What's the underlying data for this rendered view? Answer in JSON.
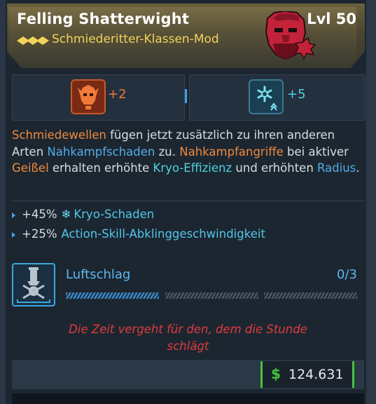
{
  "item": {
    "name": "Felling Shatterwight",
    "level": "Lvl 50",
    "type": "Schmiederitter-Klassen-Mod"
  },
  "skills": [
    {
      "icon": "fire-skull-icon",
      "bonus": "+2"
    },
    {
      "icon": "cryo-snowflake-icon",
      "bonus": "+5"
    }
  ],
  "description": {
    "p1": "Schmiedewellen",
    "p2": " fügen jetzt zusätzlich zu ihren anderen Arten ",
    "p3": "Nahkampfschaden",
    "p4": " zu. ",
    "p5": "Nahkampfangriffe",
    "p6": " bei aktiver ",
    "p7": "Geißel",
    "p8": " erhalten erhöhte ",
    "p9": "Kryo-Effizienz",
    "p10": " und erhöhten ",
    "p11": "Radius",
    "p12": "."
  },
  "stats": [
    {
      "value": "+45%",
      "label": "Kryo-Schaden",
      "icon": "snowflake-icon"
    },
    {
      "value": "+25%",
      "label": "Action-Skill-Abklinggeschwindigkeit"
    }
  ],
  "augment": {
    "name": "Luftschlag",
    "count": "0/3",
    "icon": "airstrike-skull-icon",
    "progress": 0
  },
  "flavor": {
    "line1": "Die Zeit vergeht für den, dem die Stunde",
    "line2": "schlägt"
  },
  "price": {
    "symbol": "$",
    "value": "124.631"
  },
  "colors": {
    "header_gold": "#6a5e3a",
    "legendary_yellow": "#f2d35a",
    "fire_orange": "#f08a3c",
    "cryo_cyan": "#4fd3de",
    "accent_blue": "#52aee6",
    "flavor_red": "#e03c3c",
    "money_green": "#46c43a"
  }
}
